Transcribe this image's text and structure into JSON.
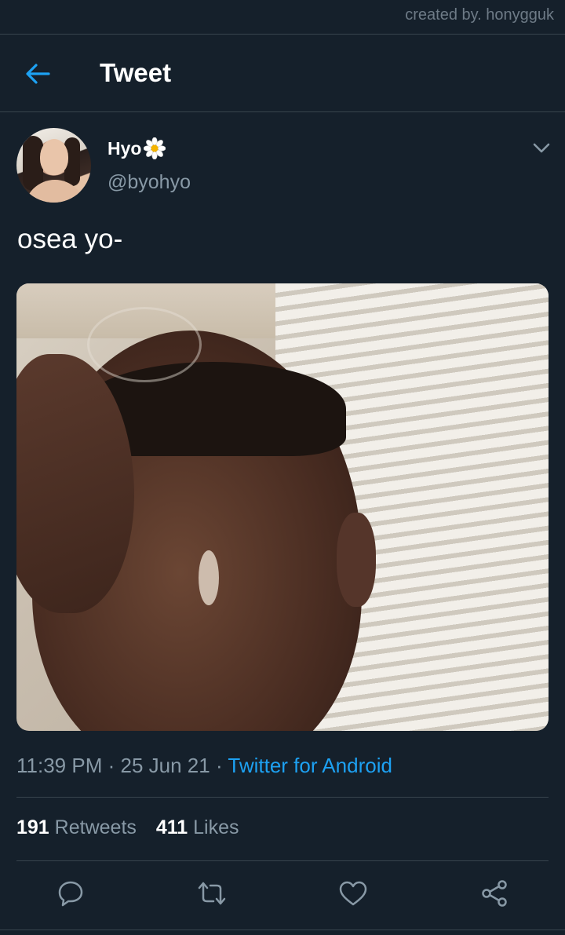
{
  "credit": "created by. honygguk",
  "header": {
    "back_icon": "arrow-left-icon",
    "title": "Tweet"
  },
  "tweet": {
    "author": {
      "name": "Hyo",
      "emoji_icon": "daisy-flower-icon",
      "handle": "@byohyo"
    },
    "text": "osea yo-",
    "time": "11:39 PM",
    "separator": "·",
    "date": "25 Jun 21",
    "source": "Twitter for Android",
    "retweets": {
      "count": "191",
      "label": "Retweets"
    },
    "likes": {
      "count": "411",
      "label": "Likes"
    }
  },
  "actions": [
    "reply-icon",
    "retweet-icon",
    "like-icon",
    "share-icon"
  ],
  "colors": {
    "background": "#15202b",
    "divider": "#38444d",
    "secondary_text": "#8899a6",
    "accent": "#1da1f2"
  }
}
